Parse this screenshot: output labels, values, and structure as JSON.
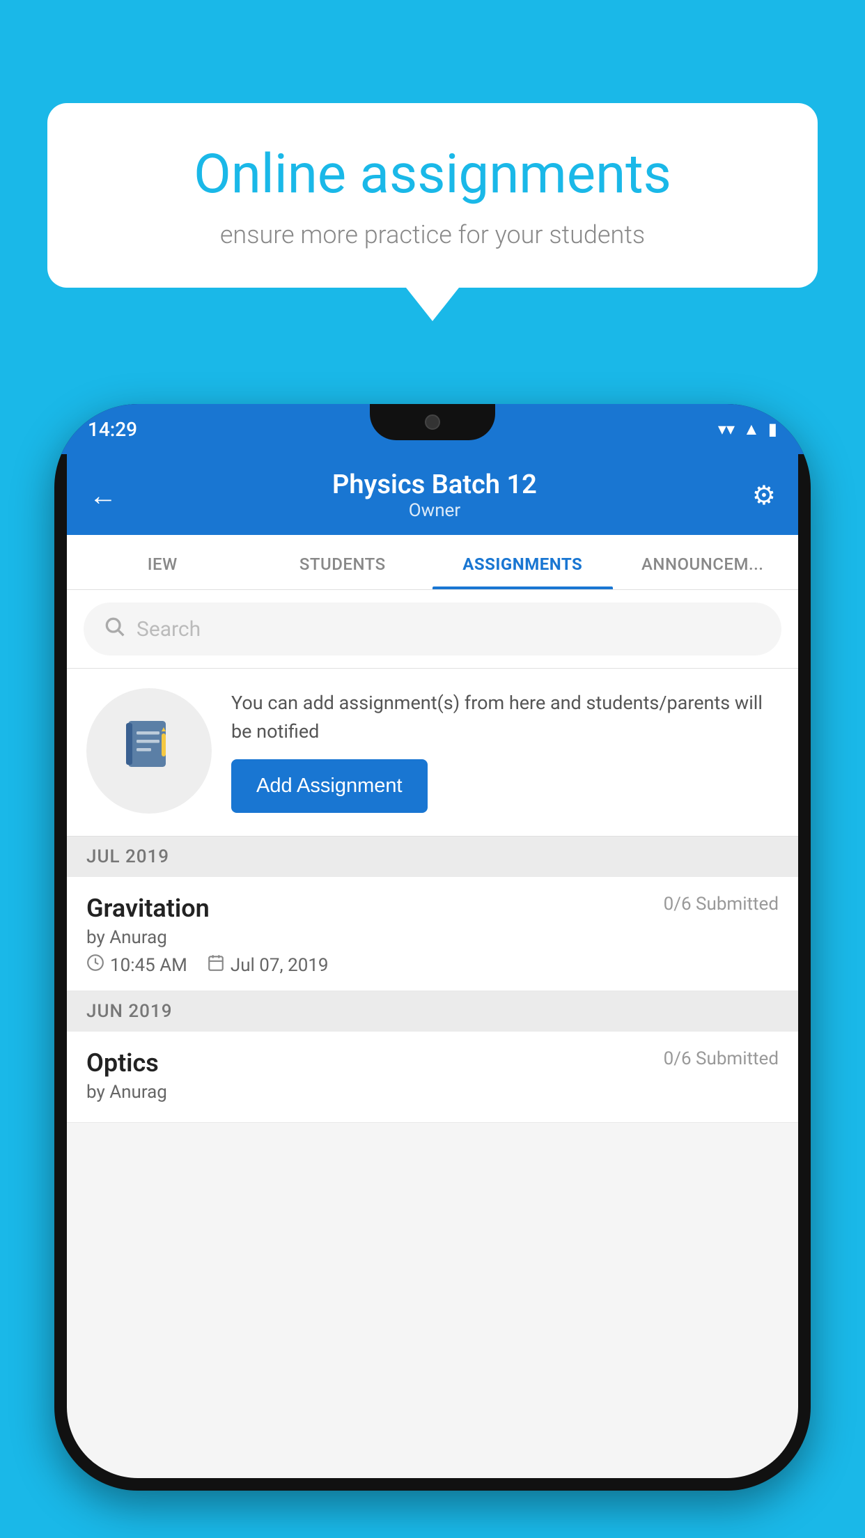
{
  "background_color": "#1ab8e8",
  "speech_bubble": {
    "title": "Online assignments",
    "subtitle": "ensure more practice for your students"
  },
  "phone": {
    "status_bar": {
      "time": "14:29",
      "icons": [
        "wifi",
        "signal",
        "battery"
      ]
    },
    "header": {
      "back_label": "←",
      "title": "Physics Batch 12",
      "subtitle": "Owner",
      "settings_label": "⚙"
    },
    "tabs": [
      {
        "label": "IEW",
        "active": false
      },
      {
        "label": "STUDENTS",
        "active": false
      },
      {
        "label": "ASSIGNMENTS",
        "active": true
      },
      {
        "label": "ANNOUNCEM...",
        "active": false
      }
    ],
    "search": {
      "placeholder": "Search"
    },
    "promo": {
      "description": "You can add assignment(s) from here and students/parents will be notified",
      "button_label": "Add Assignment"
    },
    "sections": [
      {
        "month_label": "JUL 2019",
        "assignments": [
          {
            "name": "Gravitation",
            "submitted": "0/6 Submitted",
            "by": "by Anurag",
            "time": "10:45 AM",
            "date": "Jul 07, 2019"
          }
        ]
      },
      {
        "month_label": "JUN 2019",
        "assignments": [
          {
            "name": "Optics",
            "submitted": "0/6 Submitted",
            "by": "by Anurag",
            "time": "",
            "date": ""
          }
        ]
      }
    ]
  }
}
